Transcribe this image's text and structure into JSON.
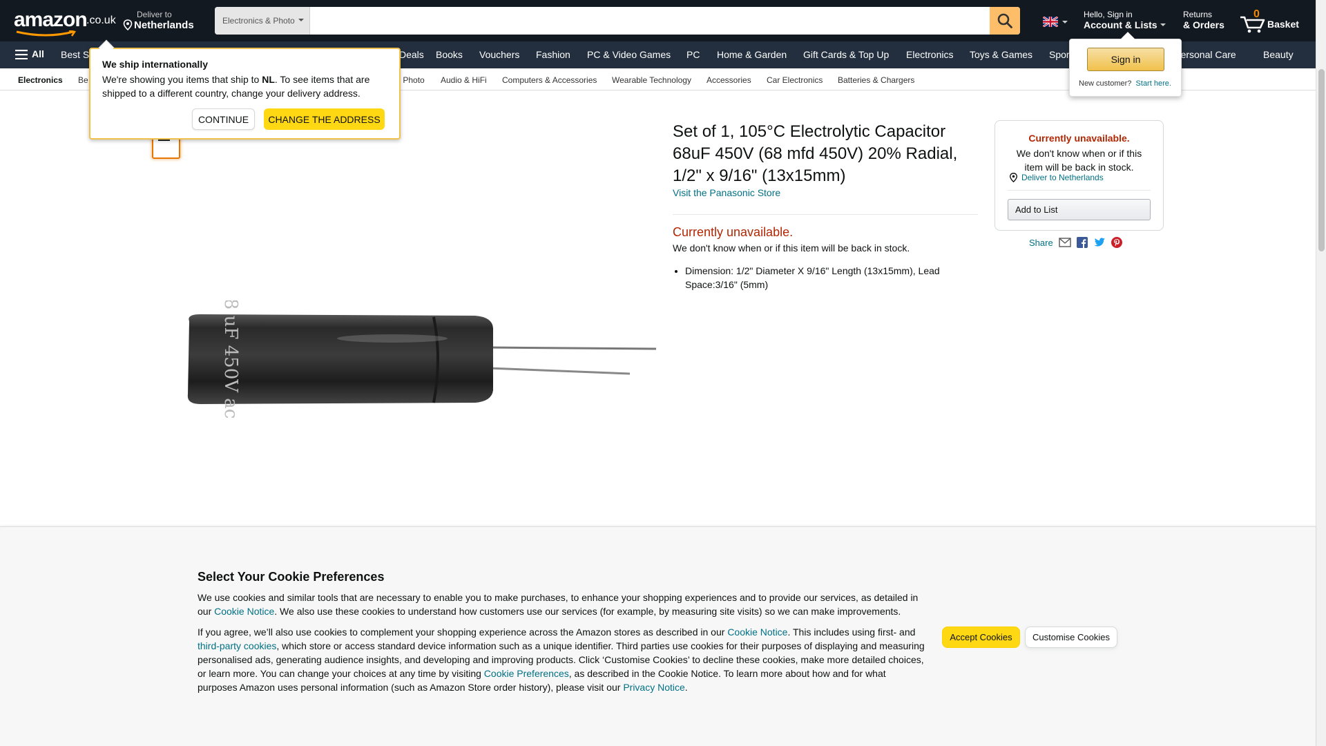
{
  "header": {
    "logo_text": "amazon",
    "logo_tld": ".co.uk",
    "deliver_small": "Deliver to",
    "deliver_location": "Netherlands",
    "search_category": "Electronics & Photo",
    "search_placeholder": "",
    "account_small": "Hello, Sign in",
    "account_big": "Account & Lists",
    "returns_small": "Returns",
    "returns_big": "& Orders",
    "basket_count": "0",
    "basket_label": "Basket"
  },
  "nav": {
    "all_label": "All",
    "items": [
      "Best S",
      "Deals",
      "Books",
      "Vouchers",
      "Fashion",
      "PC & Video Games",
      "PC",
      "Home & Garden",
      "Gift Cards & Top Up",
      "Electronics",
      "Toys & Games",
      "Spor",
      "& Personal Care",
      "Beauty"
    ]
  },
  "subnav": {
    "items": [
      "Electronics",
      "Be",
      "& Photo",
      "Audio & HiFi",
      "Computers & Accessories",
      "Wearable Technology",
      "Accessories",
      "Car Electronics",
      "Batteries & Chargers"
    ]
  },
  "intl_popover": {
    "title": "We ship internationally",
    "text_pre": "We're showing you items that ship to ",
    "country_code": "NL",
    "text_post": ". To see items that are shipped to a different country, change your delivery address.",
    "continue_label": "CONTINUE",
    "change_label": "CHANGE THE ADDRESS"
  },
  "signin_flyout": {
    "signin_label": "Sign in",
    "new_customer": "New customer?",
    "start_here": "Start here."
  },
  "product": {
    "title": "Set of 1, 105°C Electrolytic Capacitor 68uF 450V (68 mfd 450V) 20% Radial, 1/2\" x 9/16\" (13x15mm)",
    "store_link": "Visit the Panasonic Store",
    "unavailable": "Currently unavailable.",
    "unavailable_sub": "We don't know when or if this item will be back in stock.",
    "bullets": [
      "Dimension: 1/2\" Diameter X 9/16\" Length (13x15mm), Lead Space:3/16\" (5mm)"
    ]
  },
  "buybox": {
    "unavailable": "Currently unavailable.",
    "unavailable_sub": "We don't know when or if this item will be back in stock.",
    "deliver_link": "Deliver to Netherlands",
    "add_to_list": "Add to List"
  },
  "share": {
    "label": "Share"
  },
  "cookie": {
    "title": "Select Your Cookie Preferences",
    "p1_a": "We use cookies and similar tools that are necessary to enable you to make purchases, to enhance your shopping experiences and to provide our services, as detailed in our ",
    "p1_link": "Cookie Notice",
    "p1_b": ". We also use these cookies to understand how customers use our services (for example, by measuring site visits) so we can make improvements.",
    "p2_a": "If you agree, we’ll also use cookies to complement your shopping experience across the Amazon stores as described in our ",
    "p2_link1": "Cookie Notice",
    "p2_b": ". This includes using first- and ",
    "p2_link2": "third-party cookies",
    "p2_c": ", which store or access standard device information such as a unique identifier. Third parties use cookies for their purposes of displaying and measuring personalised ads, generating audience insights, and developing and improving products. Click ‘Customise Cookies’ to decline these cookies, make more detailed choices, or learn more. You can change your choices at any time by visiting ",
    "p2_link3": "Cookie Preferences",
    "p2_d": ", as described in the Cookie Notice. To learn more about how and for what purposes Amazon uses personal information (such as Amazon Store order history), please visit our ",
    "p2_link4": "Privacy Notice",
    "p2_e": ".",
    "accept_label": "Accept Cookies",
    "customise_label": "Customise Cookies"
  },
  "image_text": {
    "capacitor_print": "68 uF 450V acon"
  },
  "colors": {
    "header_bg": "#131921",
    "nav_bg": "#232f3e",
    "search_button": "#febd69",
    "primary_button": "#ffd814",
    "link": "#007185",
    "unavailable": "#b12704",
    "basket_count": "#f08804"
  },
  "icons": {
    "search": "magnifier-icon",
    "location": "location-pin-icon",
    "flag": "uk-flag-icon",
    "cart": "cart-icon",
    "menu": "hamburger-icon",
    "share_email": "email-icon",
    "share_facebook": "facebook-icon",
    "share_twitter": "twitter-icon",
    "share_pinterest": "pinterest-icon"
  }
}
